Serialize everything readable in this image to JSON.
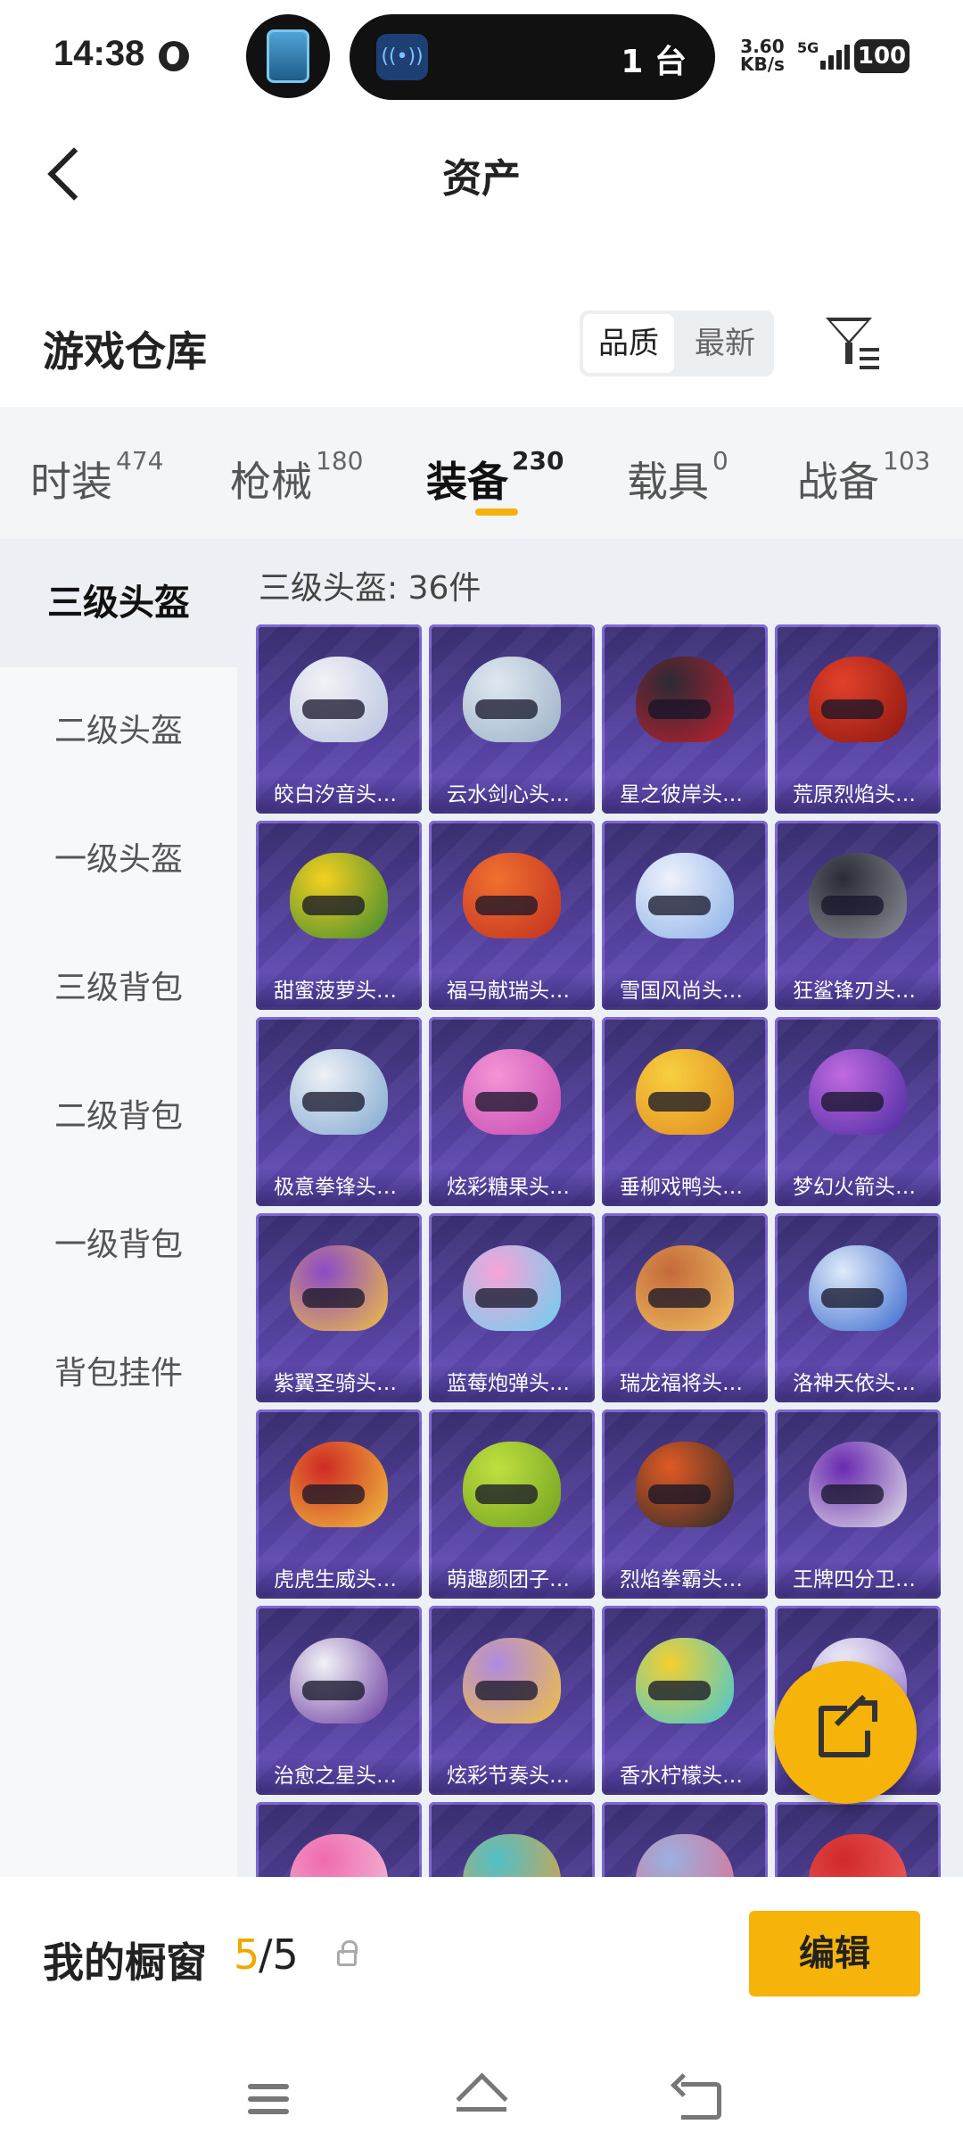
{
  "status_bar": {
    "time": "14:38",
    "island_count": "1 台",
    "speed_value": "3.60",
    "speed_unit": "KB/s",
    "network": "5G",
    "battery": "100"
  },
  "header": {
    "title": "资产",
    "back_icon": "chevron-left-icon"
  },
  "section": {
    "title": "游戏仓库",
    "sort_options": [
      "品质",
      "最新"
    ],
    "sort_selected": "品质",
    "filter_icon": "filter-icon"
  },
  "tabs": [
    {
      "label": "时装",
      "count": "474"
    },
    {
      "label": "枪械",
      "count": "180"
    },
    {
      "label": "装备",
      "count": "230"
    },
    {
      "label": "载具",
      "count": "0"
    },
    {
      "label": "战备",
      "count": "103"
    }
  ],
  "active_tab": "装备",
  "subcategories": [
    "三级头盔",
    "二级头盔",
    "一级头盔",
    "三级背包",
    "二级背包",
    "一级背包",
    "背包挂件"
  ],
  "active_subcategory": "三级头盔",
  "count_label": "三级头盔: 36件",
  "items": [
    {
      "name": "皎白汐音头…",
      "colors": [
        "#f2f2f6",
        "#b9c4e0"
      ]
    },
    {
      "name": "云水剑心头…",
      "colors": [
        "#dfe8f0",
        "#9bb0c6"
      ]
    },
    {
      "name": "星之彼岸头…",
      "colors": [
        "#2a2a34",
        "#c02030"
      ]
    },
    {
      "name": "荒原烈焰头…",
      "colors": [
        "#e2402a",
        "#8c1810"
      ]
    },
    {
      "name": "甜蜜菠萝头…",
      "colors": [
        "#f5d020",
        "#3c8a30"
      ]
    },
    {
      "name": "福马献瑞头…",
      "colors": [
        "#f07030",
        "#c03020"
      ]
    },
    {
      "name": "雪国风尚头…",
      "colors": [
        "#eef2fb",
        "#8ab0e8"
      ]
    },
    {
      "name": "狂鲨锋刃头…",
      "colors": [
        "#2a2c34",
        "#8a8e98"
      ]
    },
    {
      "name": "极意拳锋头…",
      "colors": [
        "#eef0f6",
        "#7fa8d0"
      ]
    },
    {
      "name": "炫彩糖果头…",
      "colors": [
        "#f594d6",
        "#c24ab0"
      ]
    },
    {
      "name": "垂柳戏鸭头…",
      "colors": [
        "#f8d040",
        "#e08a20"
      ]
    },
    {
      "name": "梦幻火箭头…",
      "colors": [
        "#c06ae0",
        "#4a2aa0"
      ]
    },
    {
      "name": "紫翼圣骑头…",
      "colors": [
        "#8c4ac8",
        "#f0c040"
      ]
    },
    {
      "name": "蓝莓炮弹头…",
      "colors": [
        "#f6a4d8",
        "#6ad0f0"
      ]
    },
    {
      "name": "瑞龙福将头…",
      "colors": [
        "#c46a3a",
        "#f0c060"
      ]
    },
    {
      "name": "洛神天依头…",
      "colors": [
        "#dfeaf8",
        "#3a6ad0"
      ]
    },
    {
      "name": "虎虎生威头…",
      "colors": [
        "#d02a24",
        "#f0c040"
      ]
    },
    {
      "name": "萌趣颜团子…",
      "colors": [
        "#c0e040",
        "#70a020"
      ]
    },
    {
      "name": "烈焰拳霸头…",
      "colors": [
        "#e05a24",
        "#2a2a2a"
      ]
    },
    {
      "name": "王牌四分卫…",
      "colors": [
        "#6a2ab0",
        "#e0e0e8"
      ]
    },
    {
      "name": "治愈之星头…",
      "colors": [
        "#f2f2f6",
        "#6a3aa0"
      ]
    },
    {
      "name": "炫彩节奏头…",
      "colors": [
        "#b08ae0",
        "#f0c040"
      ]
    },
    {
      "name": "香水柠檬头…",
      "colors": [
        "#f4d030",
        "#40c8d8"
      ]
    },
    {
      "name": "",
      "colors": [
        "#f0f0f8",
        "#9a7ad0"
      ]
    },
    {
      "name": "",
      "colors": [
        "#f06ab0",
        "#f0c0d8"
      ]
    },
    {
      "name": "",
      "colors": [
        "#50c0c8",
        "#e0a040"
      ]
    },
    {
      "name": "",
      "colors": [
        "#9ab0e0",
        "#e07090"
      ]
    },
    {
      "name": "",
      "colors": [
        "#d02a2a",
        "#f06060"
      ]
    }
  ],
  "fab_icon": "share-external-icon",
  "showcase": {
    "label": "我的橱窗",
    "used": "5",
    "total": "/5",
    "lock_icon": "lock-icon",
    "edit_label": "编辑"
  },
  "nav_icons": [
    "menu-icon",
    "home-icon",
    "back-nav-icon"
  ]
}
